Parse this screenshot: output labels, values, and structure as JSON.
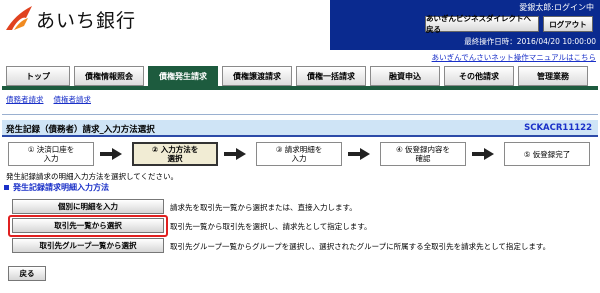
{
  "header": {
    "bank_name": "あいち銀行",
    "user_name": "愛銀太郎:ログイン中",
    "btn_back_direct": "あいぎんビジネスダイレクトへ戻る",
    "btn_logout": "ログアウト",
    "last_operation": "最終操作日時：2016/04/20 10:00:00",
    "manual_link": "あいぎんでんさいネット操作マニュアルはこちら"
  },
  "tabs": [
    {
      "label": "トップ",
      "active": false
    },
    {
      "label": "債権情報照会",
      "active": false
    },
    {
      "label": "債権発生請求",
      "active": true
    },
    {
      "label": "債権譲渡請求",
      "active": false
    },
    {
      "label": "債権一括請求",
      "active": false
    },
    {
      "label": "融資申込",
      "active": false
    },
    {
      "label": "その他請求",
      "active": false
    },
    {
      "label": "管理業務",
      "active": false
    }
  ],
  "subnav": [
    "債務者請求",
    "債権者請求"
  ],
  "title": "発生記録（債務者）請求_入力方法選択",
  "screen_id": "SCKACR11122",
  "steps": [
    {
      "line1": "① 決済口座を",
      "line2": "入力"
    },
    {
      "line1": "② 入力方法を",
      "line2": "選択"
    },
    {
      "line1": "③ 請求明細を",
      "line2": "入力"
    },
    {
      "line1": "④ 仮登録内容を",
      "line2": "確認"
    },
    {
      "line1": "⑤ 仮登録完了",
      "line2": ""
    }
  ],
  "instruction": "発生記録請求の明細入力方法を選択してください。",
  "section_title": "発生記録請求明細入力方法",
  "options": [
    {
      "label": "個別に明細を入力",
      "desc": "請求先を取引先一覧から選択または、直接入力します。"
    },
    {
      "label": "取引先一覧から選択",
      "desc": "取引先一覧から取引先を選択し、請求先として指定します。"
    },
    {
      "label": "取引先グループ一覧から選択",
      "desc": "取引先グループ一覧からグループを選択し、選択されたグループに所属する全取引先を請求先として指定します。"
    }
  ],
  "back_label": "戻る",
  "colors": {
    "header_bg": "#0a2a8f",
    "active_tab": "#1d5b3e",
    "title_bg": "#cfe4f6",
    "link": "#1a30c8",
    "highlight": "#e02020"
  }
}
